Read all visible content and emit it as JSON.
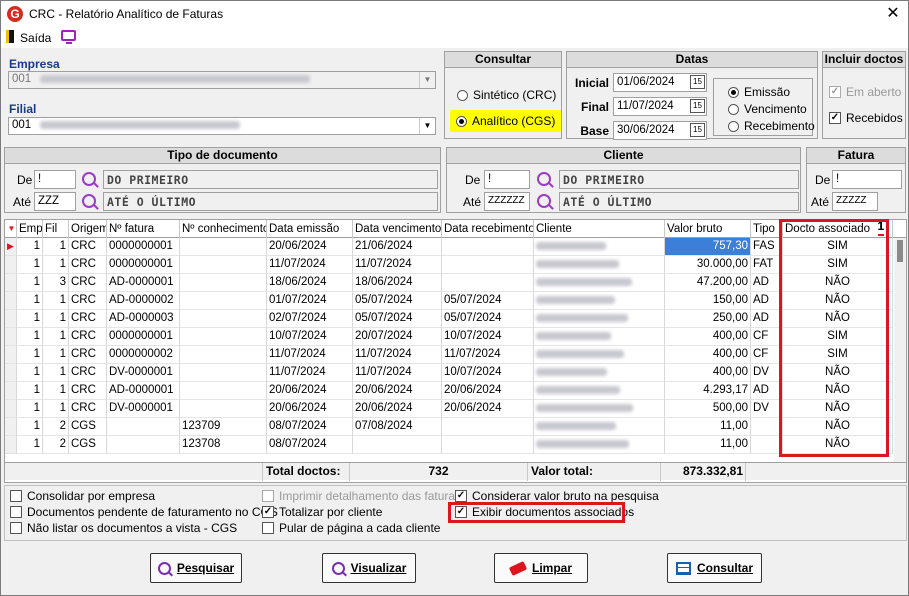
{
  "window": {
    "title": "CRC - Relatório Analítico de Faturas",
    "close": "✕",
    "logo_letter": "G"
  },
  "toolbar": {
    "exit_label": "Saída"
  },
  "empresa": {
    "label": "Empresa",
    "code": "001"
  },
  "filial": {
    "label": "Filial",
    "code": "001"
  },
  "consultar": {
    "title": "Consultar",
    "options": [
      "Sintético (CRC)",
      "Analítico (CGS)"
    ],
    "selected": "Analítico (CGS)"
  },
  "datas": {
    "title": "Datas",
    "inicial_label": "Inicial",
    "inicial": "01/06/2024",
    "final_label": "Final",
    "final": "11/07/2024",
    "base_label": "Base",
    "base": "30/06/2024",
    "cal_icon": "15",
    "tipos": [
      "Emissão",
      "Vencimento",
      "Recebimento"
    ],
    "selected": "Emissão"
  },
  "incluir": {
    "title": "Incluir doctos",
    "em_aberto": "Em aberto",
    "recebidos": "Recebidos"
  },
  "tipo_doc": {
    "title": "Tipo de documento",
    "de_label": "De",
    "de": "!",
    "ate_label": "Até",
    "ate": "ZZZ",
    "de_desc": "DO PRIMEIRO",
    "ate_desc": "ATÉ O ÚLTIMO"
  },
  "cliente": {
    "title": "Cliente",
    "de_label": "De",
    "de": "!",
    "ate_label": "Até",
    "ate": "ZZZZZZ",
    "de_desc": "DO PRIMEIRO",
    "ate_desc": "ATÉ O ÚLTIMO"
  },
  "fatura": {
    "title": "Fatura",
    "de_label": "De",
    "de": "!",
    "ate_label": "Até",
    "ate": "ZZZZZ"
  },
  "grid": {
    "headers": [
      "Emp",
      "Fil",
      "Origem",
      "Nº fatura",
      "Nº conhecimento",
      "Data emissão",
      "Data vencimento",
      "Data recebimento",
      "Cliente",
      "Valor bruto",
      "Tipo",
      "Docto associado"
    ],
    "sort_badge": "1",
    "rows": [
      [
        "1",
        "1",
        "CRC",
        "0000000001",
        "",
        "20/06/2024",
        "21/06/2024",
        "",
        "",
        "757,30",
        "FAS",
        "SIM"
      ],
      [
        "1",
        "1",
        "CRC",
        "0000000001",
        "",
        "11/07/2024",
        "11/07/2024",
        "",
        "",
        "30.000,00",
        "FAT",
        "SIM"
      ],
      [
        "1",
        "3",
        "CRC",
        "AD-0000001",
        "",
        "18/06/2024",
        "18/06/2024",
        "",
        "",
        "47.200,00",
        "AD",
        "NÃO"
      ],
      [
        "1",
        "1",
        "CRC",
        "AD-0000002",
        "",
        "01/07/2024",
        "05/07/2024",
        "05/07/2024",
        "",
        "150,00",
        "AD",
        "NÃO"
      ],
      [
        "1",
        "1",
        "CRC",
        "AD-0000003",
        "",
        "02/07/2024",
        "05/07/2024",
        "05/07/2024",
        "",
        "250,00",
        "AD",
        "NÃO"
      ],
      [
        "1",
        "1",
        "CRC",
        "0000000001",
        "",
        "10/07/2024",
        "20/07/2024",
        "10/07/2024",
        "",
        "400,00",
        "CF",
        "SIM"
      ],
      [
        "1",
        "1",
        "CRC",
        "0000000002",
        "",
        "11/07/2024",
        "11/07/2024",
        "11/07/2024",
        "",
        "400,00",
        "CF",
        "SIM"
      ],
      [
        "1",
        "1",
        "CRC",
        "DV-0000001",
        "",
        "11/07/2024",
        "11/07/2024",
        "10/07/2024",
        "",
        "400,00",
        "DV",
        "NÃO"
      ],
      [
        "1",
        "1",
        "CRC",
        "AD-0000001",
        "",
        "20/06/2024",
        "20/06/2024",
        "20/06/2024",
        "",
        "4.293,17",
        "AD",
        "NÃO"
      ],
      [
        "1",
        "1",
        "CRC",
        "DV-0000001",
        "",
        "20/06/2024",
        "20/06/2024",
        "20/06/2024",
        "",
        "500,00",
        "DV",
        "NÃO"
      ],
      [
        "1",
        "2",
        "CGS",
        "",
        "123709",
        "08/07/2024",
        "07/08/2024",
        "",
        "",
        "11,00",
        "",
        "NÃO"
      ],
      [
        "1",
        "2",
        "CGS",
        "",
        "123708",
        "08/07/2024",
        "",
        "",
        "",
        "11,00",
        "",
        "NÃO"
      ]
    ],
    "total_doctos_label": "Total doctos:",
    "total_doctos": "732",
    "valor_total_label": "Valor total:",
    "valor_total": "873.332,81"
  },
  "options": {
    "consolidar": "Consolidar por empresa",
    "pendentes": "Documentos pendente de faturamento no CGS",
    "nao_listar": "Não listar os documentos a vista - CGS",
    "imprimir": "Imprimir detalhamento das faturas",
    "totalizar": "Totalizar por cliente",
    "pular": "Pular de página a cada cliente",
    "considerar": "Considerar valor bruto na pesquisa",
    "exibir": "Exibir documentos associados"
  },
  "buttons": {
    "pesquisar": "Pesquisar",
    "visualizar": "Visualizar",
    "limpar": "Limpar",
    "consultar": "Consultar"
  },
  "colors": {
    "highlight_red": "#e0141e",
    "selected_value_bg": "#3b7fd9",
    "radio_highlight": "#ffff00"
  }
}
